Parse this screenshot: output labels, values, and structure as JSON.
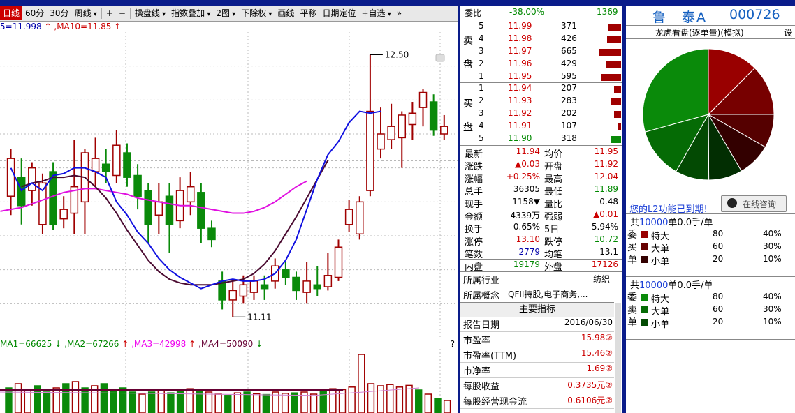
{
  "toolbar": {
    "items": [
      "日线",
      "60分",
      "30分",
      "周线",
      "+",
      "−",
      "操盘线",
      "指数叠加",
      "2图",
      "下除权",
      "画线",
      "平移",
      "日期定位",
      "+自选",
      "»"
    ]
  },
  "ma_header": {
    "ma5": "5=11.998",
    "ma10": ",MA10=11.85"
  },
  "price_labels": {
    "high": "12.50",
    "low": "11.11"
  },
  "vol_header": {
    "ma1": "MA1=66625",
    "ma2": ",MA2=67266",
    "ma3": ",MA3=42998",
    "ma4": ",MA4=50090",
    "qmark": "?"
  },
  "book": {
    "wb_label": "委比",
    "wb_pct": "-38.00%",
    "wb_val": "1369",
    "sell_label": [
      "卖",
      "盘"
    ],
    "buy_label": [
      "买",
      "盘"
    ],
    "sells": [
      {
        "lv": "5",
        "price": "11.99",
        "vol": "371"
      },
      {
        "lv": "4",
        "price": "11.98",
        "vol": "426"
      },
      {
        "lv": "3",
        "price": "11.97",
        "vol": "665"
      },
      {
        "lv": "2",
        "price": "11.96",
        "vol": "429"
      },
      {
        "lv": "1",
        "price": "11.95",
        "vol": "595"
      }
    ],
    "buys": [
      {
        "lv": "1",
        "price": "11.94",
        "vol": "207"
      },
      {
        "lv": "2",
        "price": "11.93",
        "vol": "283"
      },
      {
        "lv": "3",
        "price": "11.92",
        "vol": "202"
      },
      {
        "lv": "4",
        "price": "11.91",
        "vol": "107"
      },
      {
        "lv": "5",
        "price": "11.90",
        "vol": "318"
      }
    ],
    "stats": [
      {
        "l1": "最新",
        "v1": "11.94",
        "c1": "red",
        "l2": "均价",
        "v2": "11.95",
        "c2": "red"
      },
      {
        "l1": "涨跌",
        "v1": "▲0.03",
        "c1": "red",
        "l2": "开盘",
        "v2": "11.92",
        "c2": "red"
      },
      {
        "l1": "涨幅",
        "v1": "+0.25%",
        "c1": "red",
        "l2": "最高",
        "v2": "12.04",
        "c2": "red"
      },
      {
        "l1": "总手",
        "v1": "36305",
        "c1": "black",
        "l2": "最低",
        "v2": "11.89",
        "c2": "green"
      },
      {
        "l1": "现手",
        "v1": "1158▼",
        "c1": "black",
        "l2": "量比",
        "v2": "0.48",
        "c2": "black"
      },
      {
        "l1": "金额",
        "v1": "4339万",
        "c1": "black",
        "l2": "强弱",
        "v2": "▲0.01",
        "c2": "red"
      },
      {
        "l1": "换手",
        "v1": "0.65%",
        "c1": "black",
        "l2": "5日",
        "v2": "5.94%",
        "c2": "black"
      },
      {
        "l1": "涨停",
        "v1": "13.10",
        "c1": "red",
        "l2": "跌停",
        "v2": "10.72",
        "c2": "green"
      },
      {
        "l1": "笔数",
        "v1": "2779",
        "c1": "blue",
        "l2": "均笔",
        "v2": "13.1",
        "c2": "black"
      },
      {
        "l1": "内盘",
        "v1": "19179",
        "c1": "green",
        "l2": "外盘",
        "v2": "17126",
        "c2": "red"
      }
    ],
    "industry_label": "所属行业",
    "industry_val": "纺织",
    "concept_label": "所属概念",
    "concept_val": "QFII持股,电子商务,...",
    "main_title": "主要指标",
    "indicators": [
      {
        "label": "报告日期",
        "value": "2016/06/30",
        "cls": "black"
      },
      {
        "label": "市盈率",
        "value": "15.98②",
        "cls": "red"
      },
      {
        "label": "市盈率(TTM)",
        "value": "15.46②",
        "cls": "red"
      },
      {
        "label": "市净率",
        "value": "1.69②",
        "cls": "red"
      },
      {
        "label": "每股收益",
        "value": "0.3735元②",
        "cls": "red"
      },
      {
        "label": "每股经营现金流",
        "value": "0.6106元②",
        "cls": "red"
      }
    ]
  },
  "side": {
    "stock_name": "鲁　泰A",
    "stock_code": "000726",
    "subtitle": "龙虎看盘(逐单量)(模拟)",
    "settings": "设",
    "l2_text": "您的L2功能已到期!",
    "consult_btn": "在线咨询",
    "sell_block": {
      "title_pre": "共",
      "title_num": "10000",
      "title_post": "单0.0手/单",
      "side_label": [
        "委",
        "买",
        "单"
      ],
      "rows": [
        {
          "name": "特大",
          "count": "80",
          "pct": "40%",
          "color": "#990000"
        },
        {
          "name": "大单",
          "count": "60",
          "pct": "30%",
          "color": "#660000"
        },
        {
          "name": "小单",
          "count": "20",
          "pct": "10%",
          "color": "#330000"
        }
      ]
    },
    "buy_block": {
      "title_pre": "共",
      "title_num": "10000",
      "title_post": "单0.0手/单",
      "side_label": [
        "委",
        "卖",
        "单"
      ],
      "rows": [
        {
          "name": "特大",
          "count": "80",
          "pct": "40%",
          "color": "#0a8a0a"
        },
        {
          "name": "大单",
          "count": "60",
          "pct": "30%",
          "color": "#056b05"
        },
        {
          "name": "小单",
          "count": "20",
          "pct": "10%",
          "color": "#034a03"
        }
      ]
    },
    "pie": [
      {
        "label": "red-1",
        "value": 12.5,
        "color": "#990000"
      },
      {
        "label": "red-2",
        "value": 12.5,
        "color": "#770000"
      },
      {
        "label": "red-3",
        "value": 8.3,
        "color": "#550000"
      },
      {
        "label": "red-4",
        "value": 8.3,
        "color": "#330000"
      },
      {
        "label": "green-4",
        "value": 8.3,
        "color": "#022e02"
      },
      {
        "label": "green-3",
        "value": 8.3,
        "color": "#034a03"
      },
      {
        "label": "green-2",
        "value": 12.5,
        "color": "#056b05"
      },
      {
        "label": "green-1",
        "value": 29.3,
        "color": "#0a8a0a"
      }
    ]
  },
  "chart_data": {
    "type": "candlestick",
    "price_range": [
      11.0,
      12.62
    ],
    "candles": [
      {
        "o": 11.75,
        "c": 11.95,
        "h": 12.0,
        "l": 11.65
      },
      {
        "o": 11.85,
        "c": 11.7,
        "h": 11.95,
        "l": 11.6
      },
      {
        "o": 11.78,
        "c": 11.9,
        "h": 11.93,
        "l": 11.7
      },
      {
        "o": 11.6,
        "c": 11.82,
        "h": 11.87,
        "l": 11.55
      },
      {
        "o": 11.88,
        "c": 11.6,
        "h": 11.93,
        "l": 11.57
      },
      {
        "o": 11.63,
        "c": 11.68,
        "h": 11.75,
        "l": 11.58
      },
      {
        "o": 11.66,
        "c": 11.8,
        "h": 12.05,
        "l": 11.55
      },
      {
        "o": 11.72,
        "c": 11.98,
        "h": 12.0,
        "l": 11.55
      },
      {
        "o": 11.88,
        "c": 11.95,
        "h": 12.06,
        "l": 11.8
      },
      {
        "o": 11.92,
        "c": 11.88,
        "h": 12.0,
        "l": 11.82
      },
      {
        "o": 11.86,
        "c": 12.02,
        "h": 12.1,
        "l": 11.82
      },
      {
        "o": 11.98,
        "c": 11.85,
        "h": 12.03,
        "l": 11.8
      },
      {
        "o": 11.86,
        "c": 11.75,
        "h": 11.92,
        "l": 11.68
      },
      {
        "o": 11.78,
        "c": 11.6,
        "h": 11.82,
        "l": 11.5
      },
      {
        "o": 11.65,
        "c": 11.72,
        "h": 11.82,
        "l": 11.55
      },
      {
        "o": 11.75,
        "c": 11.6,
        "h": 11.82,
        "l": 11.45
      },
      {
        "o": 11.62,
        "c": 11.78,
        "h": 11.85,
        "l": 11.58
      },
      {
        "o": 11.72,
        "c": 11.8,
        "h": 11.88,
        "l": 11.65
      },
      {
        "o": 11.77,
        "c": 11.58,
        "h": 11.82,
        "l": 11.5
      },
      {
        "o": 11.58,
        "c": 11.52,
        "h": 11.62,
        "l": 11.48
      },
      {
        "o": 11.3,
        "c": 11.2,
        "h": 11.35,
        "l": 11.15
      },
      {
        "o": 11.2,
        "c": 11.25,
        "h": 11.3,
        "l": 11.11
      },
      {
        "o": 11.22,
        "c": 11.28,
        "h": 11.33,
        "l": 11.18
      },
      {
        "o": 11.24,
        "c": 11.3,
        "h": 11.33,
        "l": 11.2
      },
      {
        "o": 11.28,
        "c": 11.26,
        "h": 11.33,
        "l": 11.2
      },
      {
        "o": 11.3,
        "c": 11.38,
        "h": 11.42,
        "l": 11.26
      },
      {
        "o": 11.36,
        "c": 11.32,
        "h": 11.4,
        "l": 11.28
      },
      {
        "o": 11.32,
        "c": 11.25,
        "h": 11.35,
        "l": 11.2
      },
      {
        "o": 11.24,
        "c": 11.3,
        "h": 11.4,
        "l": 11.18
      },
      {
        "o": 11.28,
        "c": 11.26,
        "h": 11.38,
        "l": 11.22
      },
      {
        "o": 11.27,
        "c": 11.33,
        "h": 11.45,
        "l": 11.25
      },
      {
        "o": 11.32,
        "c": 11.48,
        "h": 11.52,
        "l": 11.3
      },
      {
        "o": 11.6,
        "c": 11.68,
        "h": 11.73,
        "l": 11.56
      },
      {
        "o": 11.55,
        "c": 11.72,
        "h": 11.75,
        "l": 11.52
      },
      {
        "o": 11.78,
        "c": 12.2,
        "h": 12.5,
        "l": 11.75
      },
      {
        "o": 12.0,
        "c": 12.08,
        "h": 12.22,
        "l": 11.95
      },
      {
        "o": 12.05,
        "c": 12.12,
        "h": 12.24,
        "l": 12.0
      },
      {
        "o": 12.06,
        "c": 12.18,
        "h": 12.2,
        "l": 11.9
      },
      {
        "o": 12.13,
        "c": 12.19,
        "h": 12.25,
        "l": 12.05
      },
      {
        "o": 12.22,
        "c": 12.3,
        "h": 12.32,
        "l": 12.12
      },
      {
        "o": 12.25,
        "c": 12.1,
        "h": 12.29,
        "l": 12.07
      },
      {
        "o": 12.08,
        "c": 12.12,
        "h": 12.18,
        "l": 12.05
      }
    ],
    "ma5": [
      11.9,
      11.78,
      11.82,
      11.78,
      11.86,
      11.87,
      11.9,
      11.9,
      11.88,
      11.85,
      11.72,
      11.65,
      11.56,
      11.5,
      11.42,
      11.36,
      11.32,
      11.29,
      11.26,
      11.28,
      11.3,
      11.31,
      11.3,
      11.3,
      11.31,
      11.34,
      11.41,
      11.52,
      11.68,
      11.84,
      11.97,
      12.04,
      12.14,
      12.2,
      12.19,
      12.2
    ],
    "ma10": [
      11.8,
      11.82,
      11.83,
      11.85,
      11.85,
      11.86,
      11.85,
      11.8,
      11.74,
      11.66,
      11.57,
      11.49,
      11.41,
      11.35,
      11.31,
      11.29,
      11.28,
      11.28,
      11.28,
      11.29,
      11.3,
      11.31,
      11.34,
      11.39,
      11.46,
      11.55,
      11.64,
      11.74,
      11.84,
      11.94
    ],
    "ma20": [
      11.67,
      11.68,
      11.69,
      11.71,
      11.73,
      11.75,
      11.77,
      11.78,
      11.79,
      11.79,
      11.78,
      11.77,
      11.76,
      11.74,
      11.73,
      11.72,
      11.71,
      11.7,
      11.7,
      11.69,
      11.68,
      11.67,
      11.66,
      11.66,
      11.67,
      11.69,
      11.72,
      11.76,
      11.8,
      11.83
    ],
    "volumes": [
      0.6,
      0.7,
      0.55,
      0.65,
      0.5,
      0.6,
      0.7,
      0.75,
      0.6,
      0.65,
      0.7,
      0.55,
      0.6,
      0.5,
      0.45,
      0.5,
      0.55,
      0.48,
      0.52,
      0.58,
      0.55,
      0.5,
      0.45,
      0.42,
      0.48,
      0.5,
      0.46,
      0.44,
      0.5,
      0.47,
      0.48,
      0.5,
      0.45,
      0.55,
      0.58,
      0.56,
      0.62,
      1.4,
      0.7,
      0.65,
      0.68,
      0.62,
      0.66,
      0.55,
      0.45,
      0.35,
      0.3
    ],
    "volume_colors": [
      "g",
      "r",
      "r",
      "g",
      "g",
      "r",
      "g",
      "r",
      "g",
      "r",
      "g",
      "g",
      "g",
      "g",
      "r",
      "g",
      "r",
      "g",
      "g",
      "r",
      "g",
      "r",
      "r",
      "g",
      "r",
      "g",
      "r",
      "g",
      "r",
      "r",
      "g",
      "r",
      "r",
      "g",
      "r",
      "r",
      "r",
      "r",
      "r",
      "r",
      "r",
      "r",
      "r",
      "g",
      "r",
      "g",
      "r"
    ]
  }
}
